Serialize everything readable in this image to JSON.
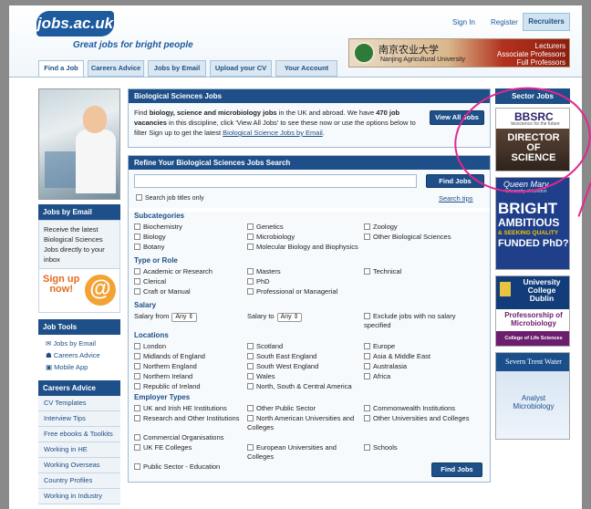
{
  "header": {
    "logo": "jobs.ac.uk",
    "tagline": "Great jobs for bright people",
    "sign_in": "Sign In",
    "register": "Register",
    "recruiters": "Recruiters",
    "tabs": [
      "Find a Job",
      "Careers Advice",
      "Jobs by Email",
      "Upload your CV",
      "Your Account"
    ],
    "banner": {
      "cn": "南京农业大学",
      "en": "Nanjing Agricultural University",
      "lines": [
        "Lecturers",
        "Associate Professors",
        "Full Professors"
      ]
    }
  },
  "left": {
    "jobs_by_email": {
      "title": "Jobs by Email",
      "text": "Receive the latest Biological Sciences Jobs directly to your inbox",
      "signup": "Sign up now!",
      "signup_lines": [
        "Sign up",
        "now!"
      ]
    },
    "job_tools": {
      "title": "Job Tools",
      "items": [
        "Jobs by Email",
        "Careers Advice",
        "Mobile App"
      ]
    },
    "careers_advice": {
      "title": "Careers Advice",
      "items": [
        "CV Templates",
        "Interview Tips",
        "Free ebooks & Toolkits",
        "Working in HE",
        "Working Overseas",
        "Country Profiles",
        "Working in Industry"
      ]
    }
  },
  "main": {
    "title": "Biological Sciences Jobs",
    "intro_1": "Find ",
    "intro_bold": "biology, science and microbiology jobs",
    "intro_2": " in the UK and abroad. We have ",
    "intro_count": "470 job vacancies",
    "intro_3": " in this discipline, click 'View All Jobs' to see these now or use the options below to filter Sign up to get the latest ",
    "intro_link": "Biological Science Jobs by Email",
    "intro_4": ".",
    "view_all": "View All Jobs",
    "refine_title": "Refine Your Biological Sciences Jobs Search",
    "search_value": "",
    "find_jobs": "Find Jobs",
    "search_tips": "Search tips",
    "search_titles_only": "Search job titles only",
    "subcategories_title": "Subcategories",
    "subcategories": [
      "Biochemistry",
      "Genetics",
      "Zoology",
      "Biology",
      "Microbiology",
      "Other Biological Sciences",
      "Botany",
      "Molecular Biology and Biophysics",
      ""
    ],
    "type_title": "Type or Role",
    "types": [
      "Academic or Research",
      "Masters",
      "Technical",
      "Clerical",
      "PhD",
      "",
      "Craft or Manual",
      "Professional or Managerial",
      ""
    ],
    "salary_title": "Salary",
    "salary_from": "Salary from",
    "salary_to": "Salary to",
    "salary_any": "Any",
    "exclude_salary": "Exclude jobs with no salary specified",
    "locations_title": "Locations",
    "locations": [
      "London",
      "Scotland",
      "Europe",
      "Midlands of England",
      "South East England",
      "Asia & Middle East",
      "Northern England",
      "South West England",
      "Australasia",
      "Northern Ireland",
      "Wales",
      "Africa",
      "Republic of Ireland",
      "North, South & Central America",
      ""
    ],
    "employer_title": "Employer Types",
    "employers": [
      "UK and Irish HE Institutions",
      "Other Public Sector",
      "Commonwealth Institutions",
      "Research and Other Institutions",
      "North American Universities and Colleges",
      "Other Universities and Colleges",
      "Commercial Organisations",
      "",
      "",
      "UK FE Colleges",
      "European Universities and Colleges",
      "Schools",
      "Public Sector - Education",
      "",
      ""
    ],
    "find_jobs_bottom": "Find Jobs"
  },
  "sidebar": {
    "header": "Sector Jobs",
    "bbsrc": {
      "name": "BBSRC",
      "sub": "bioscience for the future",
      "lines": [
        "DIRECTOR",
        "OF",
        "SCIENCE"
      ]
    },
    "qm": {
      "name": "Queen Mary",
      "sub": "University of London",
      "lines": [
        "BRIGHT",
        "AMBITIOUS",
        "& SEEKING QUALITY",
        "FUNDED PhD?"
      ]
    },
    "ucd": {
      "lines": [
        "University",
        "College",
        "Dublin"
      ],
      "role_lines": [
        "Professorship of",
        "Microbiology"
      ],
      "school": "College of Life Sciences"
    },
    "severn": {
      "name": "Severn Trent Water",
      "role_lines": [
        "Analyst",
        "Microbiology"
      ]
    }
  },
  "colors": {
    "brand": "#1e4f88",
    "accent": "#e56b1f",
    "annotation": "#e2278f"
  }
}
